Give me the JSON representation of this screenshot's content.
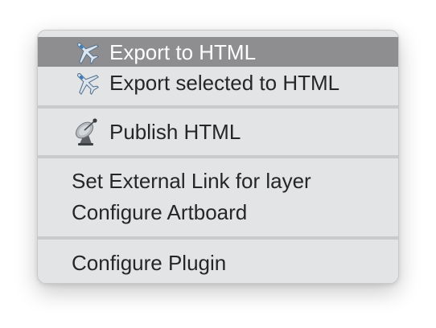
{
  "menu": {
    "items": [
      {
        "label": "Export to HTML",
        "icon": "airplane-icon",
        "highlighted": true
      },
      {
        "label": "Export selected to HTML",
        "icon": "airplane-icon",
        "highlighted": false
      },
      {
        "label": "Publish HTML",
        "icon": "satellite-dish-icon",
        "highlighted": false
      },
      {
        "label": "Set External Link for layer",
        "icon": "",
        "highlighted": false
      },
      {
        "label": "Configure Artboard",
        "icon": "",
        "highlighted": false
      },
      {
        "label": "Configure Plugin",
        "icon": "",
        "highlighted": false
      }
    ]
  },
  "colors": {
    "menu_background": "#e3e4e6",
    "highlight": "#8e8e90",
    "separator": "#c9cacc",
    "text": "#262626",
    "highlight_text": "#ffffff"
  }
}
